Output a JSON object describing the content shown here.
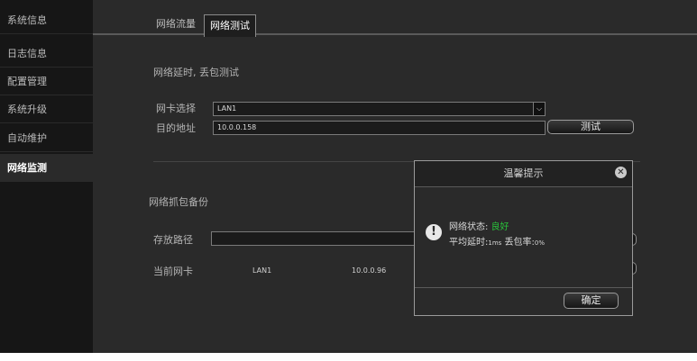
{
  "sidebar": {
    "items": [
      {
        "label": "系统信息"
      },
      {
        "label": "日志信息"
      },
      {
        "label": "配置管理"
      },
      {
        "label": "系统升级"
      },
      {
        "label": "自动维护"
      },
      {
        "label": "网络监测"
      }
    ],
    "active_index": 5
  },
  "tabs": [
    {
      "label": "网络流量"
    },
    {
      "label": "网络测试"
    }
  ],
  "latency_section": {
    "title": "网络延时, 丢包测试",
    "nic_label": "网卡选择",
    "nic_value": "LAN1",
    "dest_label": "目的地址",
    "dest_value": "10.0.0.158",
    "test_button": "测试"
  },
  "capture_section": {
    "title": "网络抓包备份",
    "path_label": "存放路径",
    "path_value": "",
    "current_nic_label": "当前网卡",
    "current_nic_value": "LAN1",
    "current_ip": "10.0.0.96"
  },
  "dialog": {
    "title": "温馨提示",
    "status_label": "网络状态: ",
    "status_value": "良好",
    "latency_label": "平均延时:",
    "latency_value": "1ms",
    "loss_label": " 丢包率:",
    "loss_value": "0%",
    "ok_button": "确定"
  },
  "colors": {
    "status_good": "#29c23a",
    "background": "#2a2a2a",
    "sidebar": "#161616"
  }
}
